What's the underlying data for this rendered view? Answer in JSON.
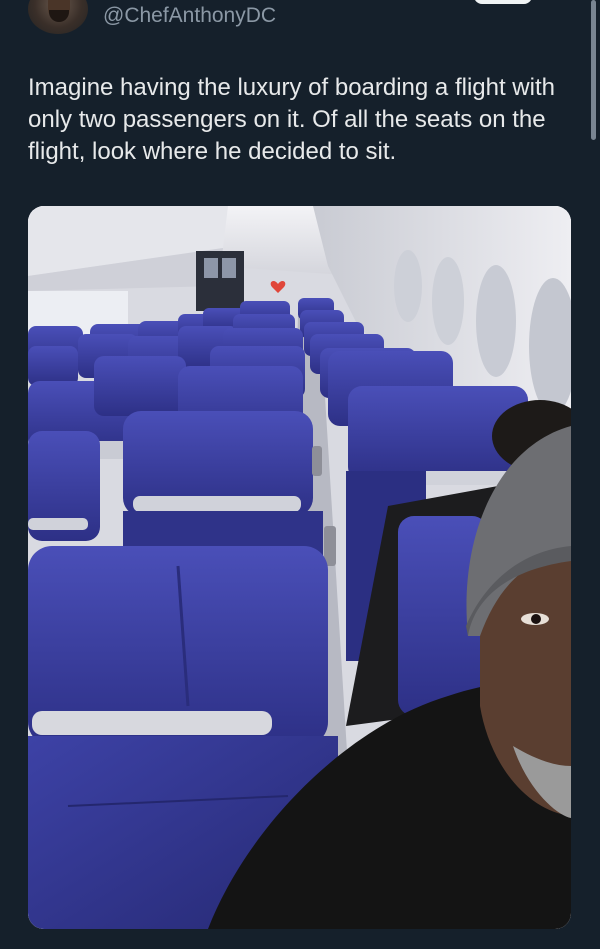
{
  "tweet": {
    "author_handle": "@ChefAnthonyDC",
    "text": "Imagine having the luxury of boarding a flight with only two passengers on it. Of all the seats on the flight,  look where he decided to sit."
  },
  "icons": {
    "avatar": "profile-avatar",
    "media": "airplane-cabin-photo"
  },
  "colors": {
    "background": "#15202b",
    "text": "#e7e9ea",
    "secondary_text": "#8b98a5",
    "seat_blue": "#3b3f9c"
  }
}
